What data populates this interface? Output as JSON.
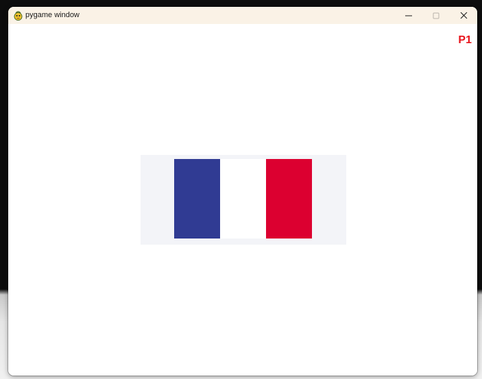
{
  "window": {
    "title": "pygame window",
    "app_icon": "pygame-snake-icon",
    "controls": {
      "minimize_icon": "minimize-icon",
      "maximize_icon": "maximize-icon",
      "close_icon": "close-icon"
    }
  },
  "game": {
    "player_label": "P1",
    "player_label_color": "#e8141c",
    "card_background": "#f3f4f8",
    "flag": {
      "stripes": [
        {
          "color": "#303b93"
        },
        {
          "color": "#ffffff"
        },
        {
          "color": "#dc0030"
        }
      ]
    }
  }
}
